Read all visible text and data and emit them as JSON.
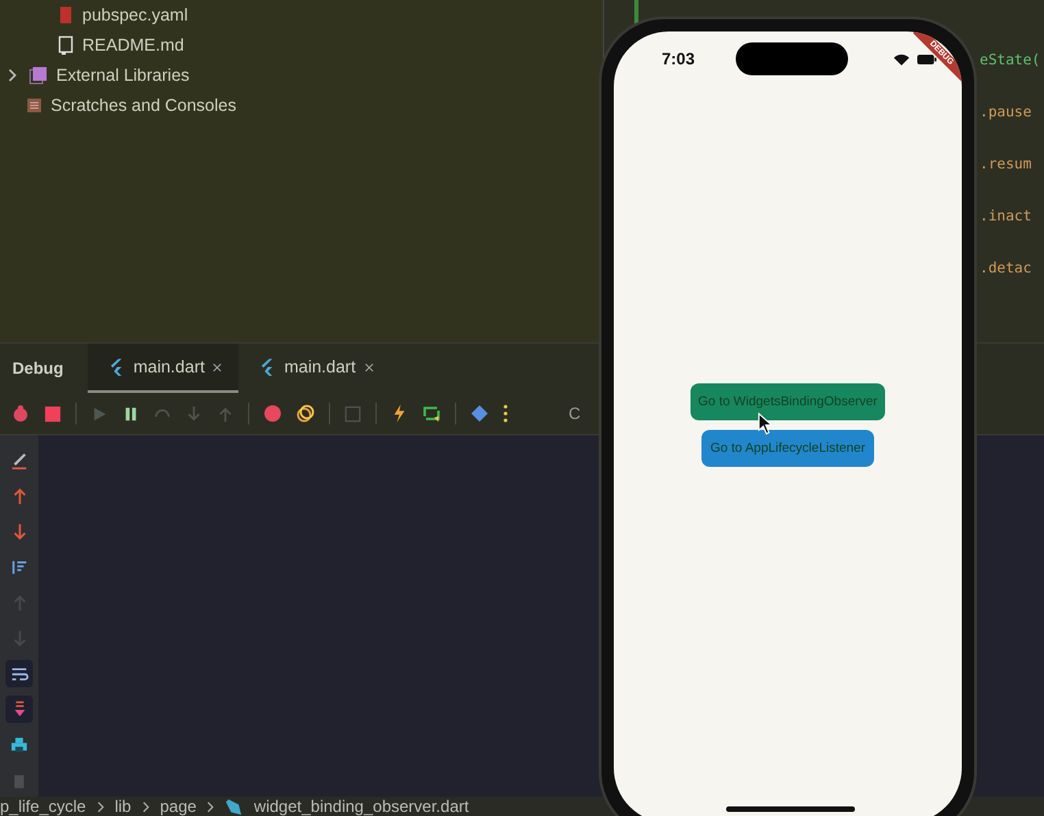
{
  "project_tree": [
    {
      "label": "pubspec.yaml",
      "kind": "yaml",
      "expandable": false,
      "indent": true
    },
    {
      "label": "README.md",
      "kind": "doc",
      "expandable": false,
      "indent": true
    },
    {
      "label": "External Libraries",
      "kind": "library",
      "expandable": true,
      "indent": false
    },
    {
      "label": "Scratches and Consoles",
      "kind": "scratch",
      "expandable": false,
      "indent": false
    }
  ],
  "editor": {
    "lines": [
      "eState(",
      ".pause",
      ".resum",
      ".inact",
      ".detac"
    ]
  },
  "debug": {
    "title": "Debug",
    "tabs": [
      {
        "label": "main.dart",
        "selected": true
      },
      {
        "label": "main.dart",
        "selected": false
      }
    ],
    "toolbar": [
      {
        "kind": "debug",
        "disabled": false
      },
      {
        "kind": "stop",
        "disabled": false
      },
      {
        "kind": "resume",
        "disabled": true
      },
      {
        "kind": "pause",
        "disabled": false
      },
      {
        "kind": "step-over",
        "disabled": true
      },
      {
        "kind": "step-into",
        "disabled": true
      },
      {
        "kind": "step-out",
        "disabled": true
      },
      {
        "kind": "breakpoints",
        "disabled": false
      },
      {
        "kind": "mute",
        "disabled": false
      },
      {
        "kind": "frame",
        "disabled": true
      },
      {
        "kind": "hot-reload",
        "disabled": false
      },
      {
        "kind": "hot-restart",
        "disabled": false
      },
      {
        "kind": "devtools",
        "disabled": false
      },
      {
        "kind": "more",
        "disabled": false
      }
    ],
    "toolbar_text": "C",
    "side_tools": [
      {
        "kind": "clear",
        "disabled": false,
        "on": false
      },
      {
        "kind": "up",
        "disabled": false,
        "on": false
      },
      {
        "kind": "down",
        "disabled": false,
        "on": false
      },
      {
        "kind": "sort",
        "disabled": false,
        "on": false
      },
      {
        "kind": "up",
        "disabled": true,
        "on": false
      },
      {
        "kind": "down",
        "disabled": true,
        "on": false
      },
      {
        "kind": "wrap",
        "disabled": false,
        "on": true
      },
      {
        "kind": "scroll-end",
        "disabled": false,
        "on": true
      },
      {
        "kind": "print",
        "disabled": false,
        "on": false
      },
      {
        "kind": "trash",
        "disabled": true,
        "on": false
      }
    ]
  },
  "breadcrumb": [
    "p_life_cycle",
    "lib",
    "page",
    "widget_binding_observer.dart"
  ],
  "phone": {
    "time": "7:03",
    "banner": "DEBUG",
    "buttons": [
      {
        "label": "Go to WidgetsBindingObserver",
        "color": "#17875f"
      },
      {
        "label": "Go to AppLifecycleListener",
        "color": "#2186cc"
      }
    ]
  }
}
